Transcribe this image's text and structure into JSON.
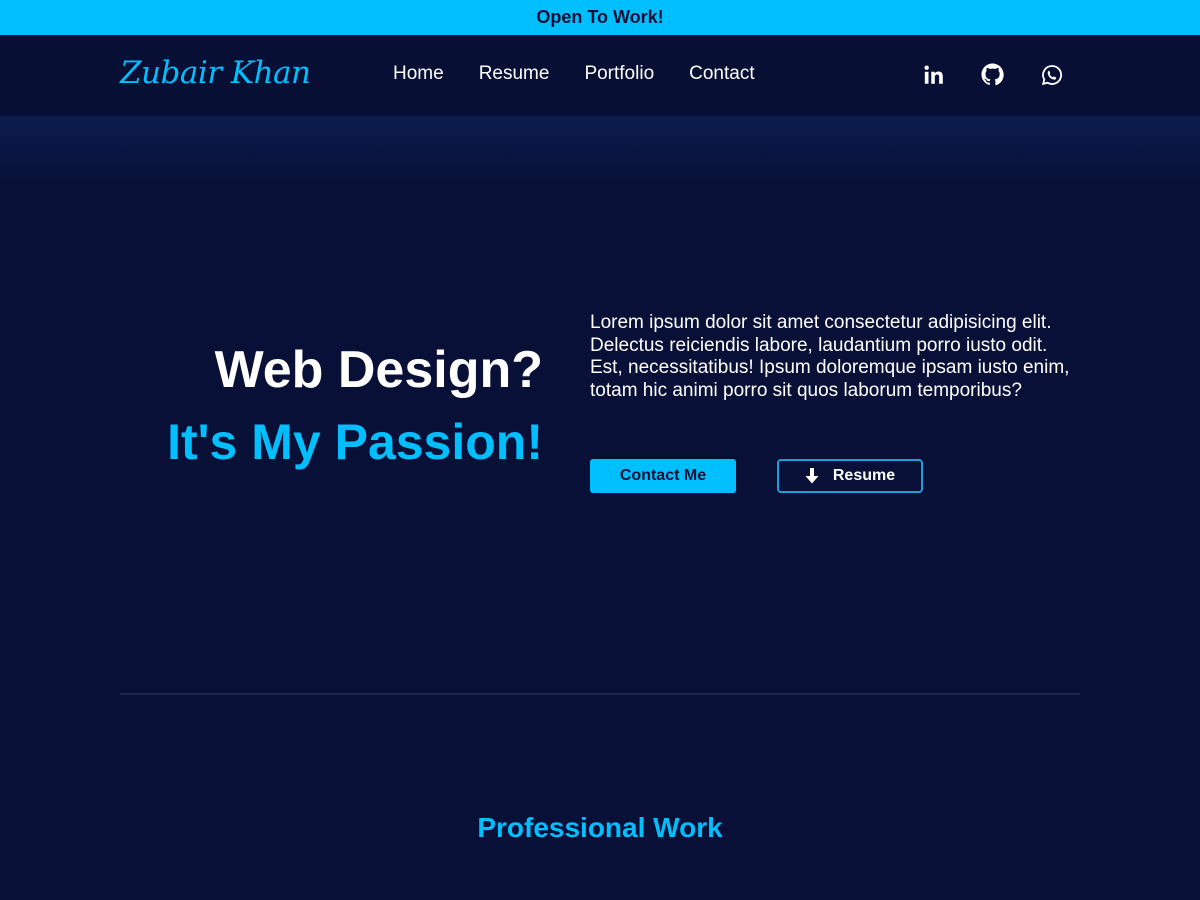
{
  "banner": {
    "text": "Open To Work!"
  },
  "navbar": {
    "logo": "Zubair Khan",
    "links": [
      {
        "label": "Home"
      },
      {
        "label": "Resume"
      },
      {
        "label": "Portfolio"
      },
      {
        "label": "Contact"
      }
    ],
    "social": [
      {
        "icon": "linkedin-icon"
      },
      {
        "icon": "github-icon"
      },
      {
        "icon": "whatsapp-icon"
      }
    ]
  },
  "hero": {
    "headline": "Web Design?",
    "subheadline": "It's My Passion!",
    "description": "Lorem ipsum dolor sit amet consectetur adipisicing elit. Delectus reiciendis labore, laudantium porro iusto odit. Est, necessitatibus! Ipsum doloremque ipsam iusto enim, totam hic animi porro sit quos laborum temporibus?",
    "contact_button": "Contact Me",
    "resume_button": "Resume",
    "resume_icon": "download-arrow-icon"
  },
  "work_section": {
    "title": "Professional Work"
  },
  "colors": {
    "accent": "#00bfff",
    "background": "#081037",
    "navbar": "#070f35",
    "banner_text": "#0a1033"
  }
}
